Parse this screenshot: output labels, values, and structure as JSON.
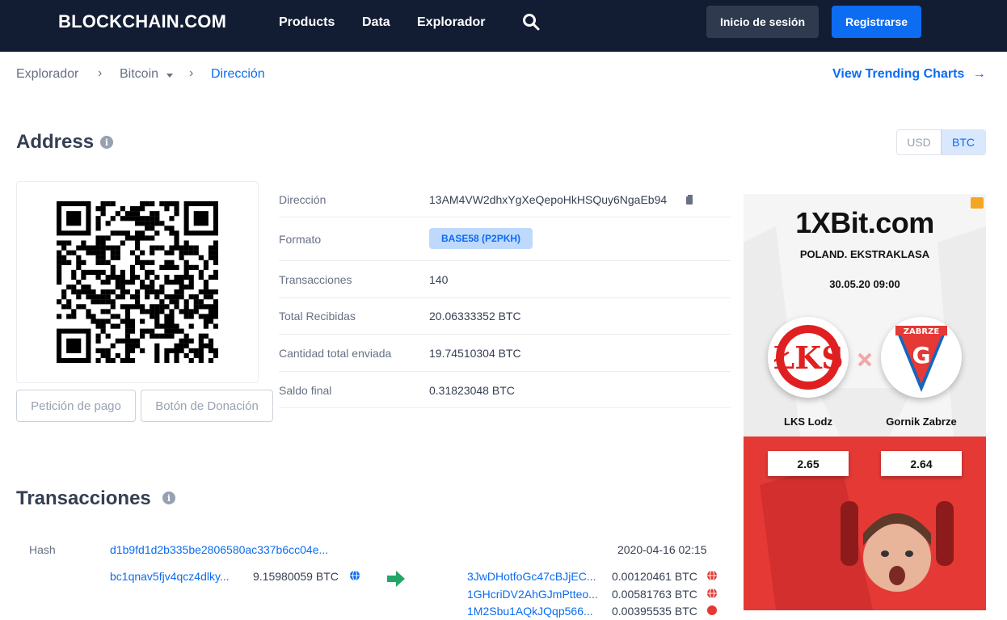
{
  "header": {
    "logo": "BLOCKCHAIN.COM",
    "nav": [
      "Products",
      "Data",
      "Explorador"
    ],
    "login": "Inicio de sesión",
    "register": "Registrarse"
  },
  "breadcrumb": {
    "items": [
      "Explorador",
      "Bitcoin",
      "Dirección"
    ],
    "trending": "View Trending Charts"
  },
  "address": {
    "title": "Address",
    "currency_options": [
      "USD",
      "BTC"
    ],
    "currency_selected": "BTC",
    "buttons": {
      "payment_request": "Petición de pago",
      "donation_button": "Botón de Donación"
    },
    "details": [
      {
        "label": "Dirección",
        "value": "13AM4VW2dhxYgXeQepoHkHSQuy6NgaEb94"
      },
      {
        "label": "Formato",
        "value": "BASE58 (P2PKH)"
      },
      {
        "label": "Transacciones",
        "value": "140"
      },
      {
        "label": "Total Recibidas",
        "value": "20.06333352 BTC"
      },
      {
        "label": "Cantidad total enviada",
        "value": "19.74510304 BTC"
      },
      {
        "label": "Saldo final",
        "value": "0.31823048 BTC"
      }
    ]
  },
  "transactions": {
    "title": "Transacciones",
    "hash_label": "Hash",
    "items": [
      {
        "hash": "d1b9fd1d2b335be2806580ac337b6cc04e...",
        "time": "2020-04-16 02:15",
        "inputs": [
          {
            "address": "bc1qnav5fjv4qcz4dlky...",
            "amount": "9.15980059 BTC"
          }
        ],
        "outputs": [
          {
            "address": "3JwDHotfoGc47cBJjEC...",
            "amount": "0.00120461 BTC"
          },
          {
            "address": "1GHcriDV2AhGJmPtteo...",
            "amount": "0.00581763 BTC"
          },
          {
            "address": "1M2Sbu1AQkJQqp566...",
            "amount": "0.00395535 BTC"
          }
        ]
      }
    ]
  },
  "ad": {
    "brand": "1XBit.com",
    "league": "POLAND. EKSTRAKLASA",
    "date": "30.05.20 09:00",
    "team1": "LKS Lodz",
    "team2": "Gornik Zabrze",
    "team2_crest_text": "ZABRZE",
    "odd1": "2.65",
    "odd2": "2.64"
  },
  "colors": {
    "header_bg": "#121d33",
    "accent": "#0c6cf2",
    "ad_red": "#e53935",
    "arrow_green": "#23a567"
  }
}
